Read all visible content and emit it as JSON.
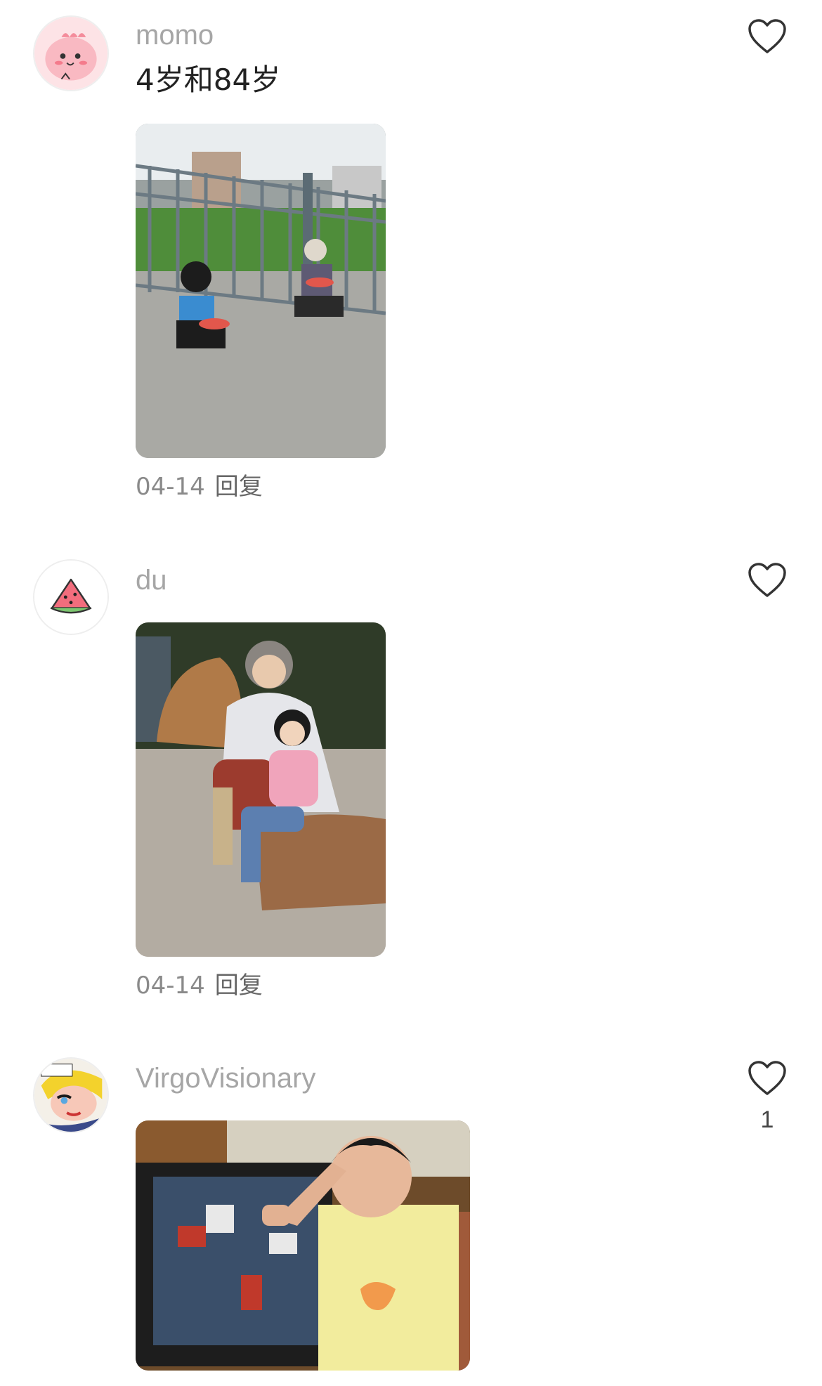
{
  "comments": [
    {
      "username": "momo",
      "text": "4岁和84岁",
      "date": "04-14",
      "reply_label": "回复",
      "like_count": "",
      "avatar_icon": "pink-dinosaur-icon",
      "photo_subject": "child-and-grandmother-eating-watermelon"
    },
    {
      "username": "du",
      "text": "",
      "date": "04-14",
      "reply_label": "回复",
      "like_count": "",
      "avatar_icon": "watermelon-slice-icon",
      "photo_subject": "grandmother-and-girl-on-rock"
    },
    {
      "username": "VirgoVisionary",
      "text": "",
      "date": "",
      "reply_label": "",
      "like_count": "1",
      "avatar_icon": "pop-art-face-icon",
      "photo_subject": "boy-saluting-by-tv"
    }
  ],
  "colors": {
    "username": "#a6a6a6",
    "text": "#222222",
    "meta": "#8a8a8a",
    "heart": "#333333"
  }
}
